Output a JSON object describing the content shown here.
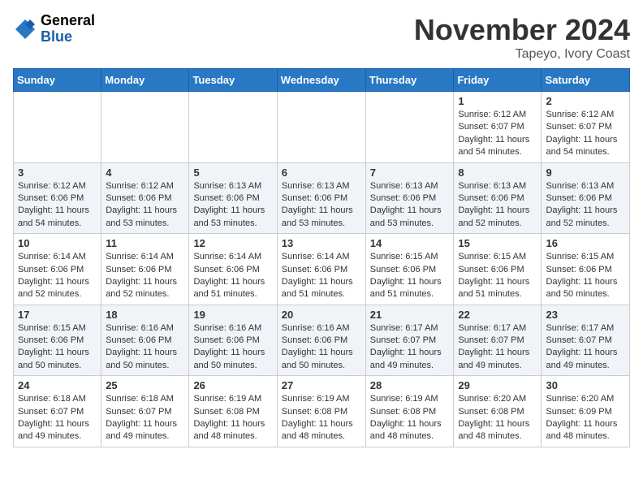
{
  "header": {
    "logo_general": "General",
    "logo_blue": "Blue",
    "month": "November 2024",
    "location": "Tapeyo, Ivory Coast"
  },
  "weekdays": [
    "Sunday",
    "Monday",
    "Tuesday",
    "Wednesday",
    "Thursday",
    "Friday",
    "Saturday"
  ],
  "weeks": [
    [
      {
        "day": "",
        "info": ""
      },
      {
        "day": "",
        "info": ""
      },
      {
        "day": "",
        "info": ""
      },
      {
        "day": "",
        "info": ""
      },
      {
        "day": "",
        "info": ""
      },
      {
        "day": "1",
        "info": "Sunrise: 6:12 AM\nSunset: 6:07 PM\nDaylight: 11 hours\nand 54 minutes."
      },
      {
        "day": "2",
        "info": "Sunrise: 6:12 AM\nSunset: 6:07 PM\nDaylight: 11 hours\nand 54 minutes."
      }
    ],
    [
      {
        "day": "3",
        "info": "Sunrise: 6:12 AM\nSunset: 6:06 PM\nDaylight: 11 hours\nand 54 minutes."
      },
      {
        "day": "4",
        "info": "Sunrise: 6:12 AM\nSunset: 6:06 PM\nDaylight: 11 hours\nand 53 minutes."
      },
      {
        "day": "5",
        "info": "Sunrise: 6:13 AM\nSunset: 6:06 PM\nDaylight: 11 hours\nand 53 minutes."
      },
      {
        "day": "6",
        "info": "Sunrise: 6:13 AM\nSunset: 6:06 PM\nDaylight: 11 hours\nand 53 minutes."
      },
      {
        "day": "7",
        "info": "Sunrise: 6:13 AM\nSunset: 6:06 PM\nDaylight: 11 hours\nand 53 minutes."
      },
      {
        "day": "8",
        "info": "Sunrise: 6:13 AM\nSunset: 6:06 PM\nDaylight: 11 hours\nand 52 minutes."
      },
      {
        "day": "9",
        "info": "Sunrise: 6:13 AM\nSunset: 6:06 PM\nDaylight: 11 hours\nand 52 minutes."
      }
    ],
    [
      {
        "day": "10",
        "info": "Sunrise: 6:14 AM\nSunset: 6:06 PM\nDaylight: 11 hours\nand 52 minutes."
      },
      {
        "day": "11",
        "info": "Sunrise: 6:14 AM\nSunset: 6:06 PM\nDaylight: 11 hours\nand 52 minutes."
      },
      {
        "day": "12",
        "info": "Sunrise: 6:14 AM\nSunset: 6:06 PM\nDaylight: 11 hours\nand 51 minutes."
      },
      {
        "day": "13",
        "info": "Sunrise: 6:14 AM\nSunset: 6:06 PM\nDaylight: 11 hours\nand 51 minutes."
      },
      {
        "day": "14",
        "info": "Sunrise: 6:15 AM\nSunset: 6:06 PM\nDaylight: 11 hours\nand 51 minutes."
      },
      {
        "day": "15",
        "info": "Sunrise: 6:15 AM\nSunset: 6:06 PM\nDaylight: 11 hours\nand 51 minutes."
      },
      {
        "day": "16",
        "info": "Sunrise: 6:15 AM\nSunset: 6:06 PM\nDaylight: 11 hours\nand 50 minutes."
      }
    ],
    [
      {
        "day": "17",
        "info": "Sunrise: 6:15 AM\nSunset: 6:06 PM\nDaylight: 11 hours\nand 50 minutes."
      },
      {
        "day": "18",
        "info": "Sunrise: 6:16 AM\nSunset: 6:06 PM\nDaylight: 11 hours\nand 50 minutes."
      },
      {
        "day": "19",
        "info": "Sunrise: 6:16 AM\nSunset: 6:06 PM\nDaylight: 11 hours\nand 50 minutes."
      },
      {
        "day": "20",
        "info": "Sunrise: 6:16 AM\nSunset: 6:06 PM\nDaylight: 11 hours\nand 50 minutes."
      },
      {
        "day": "21",
        "info": "Sunrise: 6:17 AM\nSunset: 6:07 PM\nDaylight: 11 hours\nand 49 minutes."
      },
      {
        "day": "22",
        "info": "Sunrise: 6:17 AM\nSunset: 6:07 PM\nDaylight: 11 hours\nand 49 minutes."
      },
      {
        "day": "23",
        "info": "Sunrise: 6:17 AM\nSunset: 6:07 PM\nDaylight: 11 hours\nand 49 minutes."
      }
    ],
    [
      {
        "day": "24",
        "info": "Sunrise: 6:18 AM\nSunset: 6:07 PM\nDaylight: 11 hours\nand 49 minutes."
      },
      {
        "day": "25",
        "info": "Sunrise: 6:18 AM\nSunset: 6:07 PM\nDaylight: 11 hours\nand 49 minutes."
      },
      {
        "day": "26",
        "info": "Sunrise: 6:19 AM\nSunset: 6:08 PM\nDaylight: 11 hours\nand 48 minutes."
      },
      {
        "day": "27",
        "info": "Sunrise: 6:19 AM\nSunset: 6:08 PM\nDaylight: 11 hours\nand 48 minutes."
      },
      {
        "day": "28",
        "info": "Sunrise: 6:19 AM\nSunset: 6:08 PM\nDaylight: 11 hours\nand 48 minutes."
      },
      {
        "day": "29",
        "info": "Sunrise: 6:20 AM\nSunset: 6:08 PM\nDaylight: 11 hours\nand 48 minutes."
      },
      {
        "day": "30",
        "info": "Sunrise: 6:20 AM\nSunset: 6:09 PM\nDaylight: 11 hours\nand 48 minutes."
      }
    ]
  ]
}
